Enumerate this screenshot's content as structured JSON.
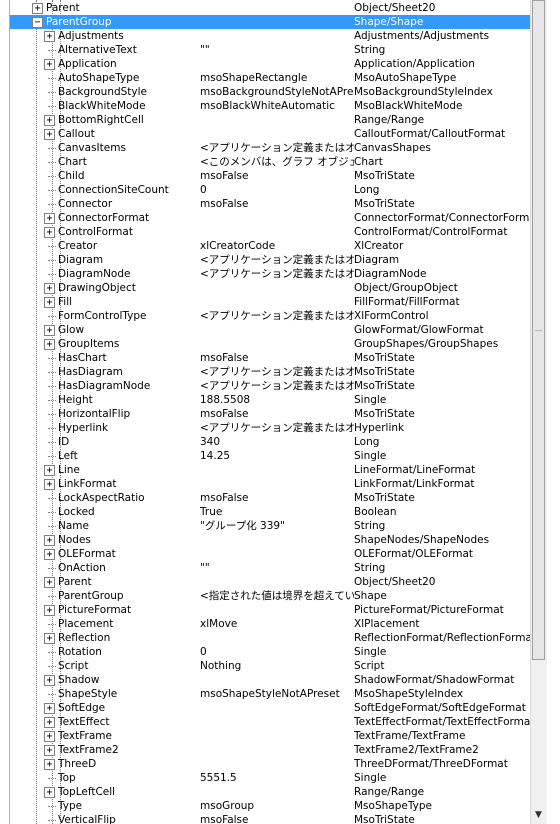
{
  "rows": [
    {
      "level": 0,
      "toggle": "plus",
      "name": "Parent",
      "value": "",
      "type": "Object/Sheet20",
      "selected": false
    },
    {
      "level": 0,
      "toggle": "minus",
      "name": "ParentGroup",
      "value": "",
      "type": "Shape/Shape",
      "selected": true
    },
    {
      "level": 1,
      "toggle": "plus",
      "name": "Adjustments",
      "value": "",
      "type": "Adjustments/Adjustments"
    },
    {
      "level": 1,
      "toggle": "none",
      "name": "AlternativeText",
      "value": "\"\"",
      "type": "String"
    },
    {
      "level": 1,
      "toggle": "plus",
      "name": "Application",
      "value": "",
      "type": "Application/Application"
    },
    {
      "level": 1,
      "toggle": "none",
      "name": "AutoShapeType",
      "value": "msoShapeRectangle",
      "type": "MsoAutoShapeType"
    },
    {
      "level": 1,
      "toggle": "none",
      "name": "BackgroundStyle",
      "value": "msoBackgroundStyleNotAPreset",
      "type": "MsoBackgroundStyleIndex"
    },
    {
      "level": 1,
      "toggle": "none",
      "name": "BlackWhiteMode",
      "value": "msoBlackWhiteAutomatic",
      "type": "MsoBlackWhiteMode"
    },
    {
      "level": 1,
      "toggle": "plus",
      "name": "BottomRightCell",
      "value": "",
      "type": "Range/Range"
    },
    {
      "level": 1,
      "toggle": "plus",
      "name": "Callout",
      "value": "",
      "type": "CalloutFormat/CalloutFormat"
    },
    {
      "level": 1,
      "toggle": "none",
      "name": "CanvasItems",
      "value": "<アプリケーション定義またはオブジェクト定義のエラーです。>",
      "type": "CanvasShapes"
    },
    {
      "level": 1,
      "toggle": "none",
      "name": "Chart",
      "value": "<このメンバは、グラフ オブジェクトにのみ有効です。>",
      "type": "Chart"
    },
    {
      "level": 1,
      "toggle": "none",
      "name": "Child",
      "value": "msoFalse",
      "type": "MsoTriState"
    },
    {
      "level": 1,
      "toggle": "none",
      "name": "ConnectionSiteCount",
      "value": "0",
      "type": "Long"
    },
    {
      "level": 1,
      "toggle": "none",
      "name": "Connector",
      "value": "msoFalse",
      "type": "MsoTriState"
    },
    {
      "level": 1,
      "toggle": "plus",
      "name": "ConnectorFormat",
      "value": "",
      "type": "ConnectorFormat/ConnectorFormat"
    },
    {
      "level": 1,
      "toggle": "plus",
      "name": "ControlFormat",
      "value": "",
      "type": "ControlFormat/ControlFormat"
    },
    {
      "level": 1,
      "toggle": "none",
      "name": "Creator",
      "value": "xlCreatorCode",
      "type": "XlCreator"
    },
    {
      "level": 1,
      "toggle": "none",
      "name": "Diagram",
      "value": "<アプリケーション定義またはオブジェクト定義のエラーです。>",
      "type": "Diagram"
    },
    {
      "level": 1,
      "toggle": "none",
      "name": "DiagramNode",
      "value": "<アプリケーション定義またはオブジェクト定義のエラーです。>",
      "type": "DiagramNode"
    },
    {
      "level": 1,
      "toggle": "plus",
      "name": "DrawingObject",
      "value": "",
      "type": "Object/GroupObject"
    },
    {
      "level": 1,
      "toggle": "plus",
      "name": "Fill",
      "value": "",
      "type": "FillFormat/FillFormat"
    },
    {
      "level": 1,
      "toggle": "none",
      "name": "FormControlType",
      "value": "<アプリケーション定義またはオブジェクト定義のエラーです。>",
      "type": "XlFormControl"
    },
    {
      "level": 1,
      "toggle": "plus",
      "name": "Glow",
      "value": "",
      "type": "GlowFormat/GlowFormat"
    },
    {
      "level": 1,
      "toggle": "plus",
      "name": "GroupItems",
      "value": "",
      "type": "GroupShapes/GroupShapes"
    },
    {
      "level": 1,
      "toggle": "none",
      "name": "HasChart",
      "value": "msoFalse",
      "type": "MsoTriState"
    },
    {
      "level": 1,
      "toggle": "none",
      "name": "HasDiagram",
      "value": "<アプリケーション定義またはオブジェクト定義のエラーです。>",
      "type": "MsoTriState"
    },
    {
      "level": 1,
      "toggle": "none",
      "name": "HasDiagramNode",
      "value": "<アプリケーション定義またはオブジェクト定義のエラーです。>",
      "type": "MsoTriState"
    },
    {
      "level": 1,
      "toggle": "none",
      "name": "Height",
      "value": "188.5508",
      "type": "Single"
    },
    {
      "level": 1,
      "toggle": "none",
      "name": "HorizontalFlip",
      "value": "msoFalse",
      "type": "MsoTriState"
    },
    {
      "level": 1,
      "toggle": "none",
      "name": "Hyperlink",
      "value": "<アプリケーション定義またはオブジェクト定義のエラーです。>",
      "type": "Hyperlink"
    },
    {
      "level": 1,
      "toggle": "none",
      "name": "ID",
      "value": "340",
      "type": "Long"
    },
    {
      "level": 1,
      "toggle": "none",
      "name": "Left",
      "value": "14.25",
      "type": "Single"
    },
    {
      "level": 1,
      "toggle": "plus",
      "name": "Line",
      "value": "",
      "type": "LineFormat/LineFormat"
    },
    {
      "level": 1,
      "toggle": "plus",
      "name": "LinkFormat",
      "value": "",
      "type": "LinkFormat/LinkFormat"
    },
    {
      "level": 1,
      "toggle": "none",
      "name": "LockAspectRatio",
      "value": "msoFalse",
      "type": "MsoTriState"
    },
    {
      "level": 1,
      "toggle": "none",
      "name": "Locked",
      "value": "True",
      "type": "Boolean"
    },
    {
      "level": 1,
      "toggle": "none",
      "name": "Name",
      "value": "\"グループ化 339\"",
      "type": "String"
    },
    {
      "level": 1,
      "toggle": "plus",
      "name": "Nodes",
      "value": "",
      "type": "ShapeNodes/ShapeNodes"
    },
    {
      "level": 1,
      "toggle": "plus",
      "name": "OLEFormat",
      "value": "",
      "type": "OLEFormat/OLEFormat"
    },
    {
      "level": 1,
      "toggle": "none",
      "name": "OnAction",
      "value": "\"\"",
      "type": "String"
    },
    {
      "level": 1,
      "toggle": "plus",
      "name": "Parent",
      "value": "",
      "type": "Object/Sheet20"
    },
    {
      "level": 1,
      "toggle": "none",
      "name": "ParentGroup",
      "value": "<指定された値は境界を超えています。>",
      "type": "Shape"
    },
    {
      "level": 1,
      "toggle": "plus",
      "name": "PictureFormat",
      "value": "",
      "type": "PictureFormat/PictureFormat"
    },
    {
      "level": 1,
      "toggle": "none",
      "name": "Placement",
      "value": "xlMove",
      "type": "XlPlacement"
    },
    {
      "level": 1,
      "toggle": "plus",
      "name": "Reflection",
      "value": "",
      "type": "ReflectionFormat/ReflectionFormat"
    },
    {
      "level": 1,
      "toggle": "none",
      "name": "Rotation",
      "value": "0",
      "type": "Single"
    },
    {
      "level": 1,
      "toggle": "none",
      "name": "Script",
      "value": "Nothing",
      "type": "Script"
    },
    {
      "level": 1,
      "toggle": "plus",
      "name": "Shadow",
      "value": "",
      "type": "ShadowFormat/ShadowFormat"
    },
    {
      "level": 1,
      "toggle": "none",
      "name": "ShapeStyle",
      "value": "msoShapeStyleNotAPreset",
      "type": "MsoShapeStyleIndex"
    },
    {
      "level": 1,
      "toggle": "plus",
      "name": "SoftEdge",
      "value": "",
      "type": "SoftEdgeFormat/SoftEdgeFormat"
    },
    {
      "level": 1,
      "toggle": "plus",
      "name": "TextEffect",
      "value": "",
      "type": "TextEffectFormat/TextEffectFormat"
    },
    {
      "level": 1,
      "toggle": "plus",
      "name": "TextFrame",
      "value": "",
      "type": "TextFrame/TextFrame"
    },
    {
      "level": 1,
      "toggle": "plus",
      "name": "TextFrame2",
      "value": "",
      "type": "TextFrame2/TextFrame2"
    },
    {
      "level": 1,
      "toggle": "plus",
      "name": "ThreeD",
      "value": "",
      "type": "ThreeDFormat/ThreeDFormat"
    },
    {
      "level": 1,
      "toggle": "none",
      "name": "Top",
      "value": "5551.5",
      "type": "Single"
    },
    {
      "level": 1,
      "toggle": "plus",
      "name": "TopLeftCell",
      "value": "",
      "type": "Range/Range"
    },
    {
      "level": 1,
      "toggle": "none",
      "name": "Type",
      "value": "msoGroup",
      "type": "MsoShapeType"
    },
    {
      "level": 1,
      "toggle": "none",
      "name": "VerticalFlip",
      "value": "msoFalse",
      "type": "MsoTriState"
    }
  ],
  "scrollbar": {
    "down_arrow": "▼"
  },
  "colors": {
    "selection": "#3399ff"
  }
}
